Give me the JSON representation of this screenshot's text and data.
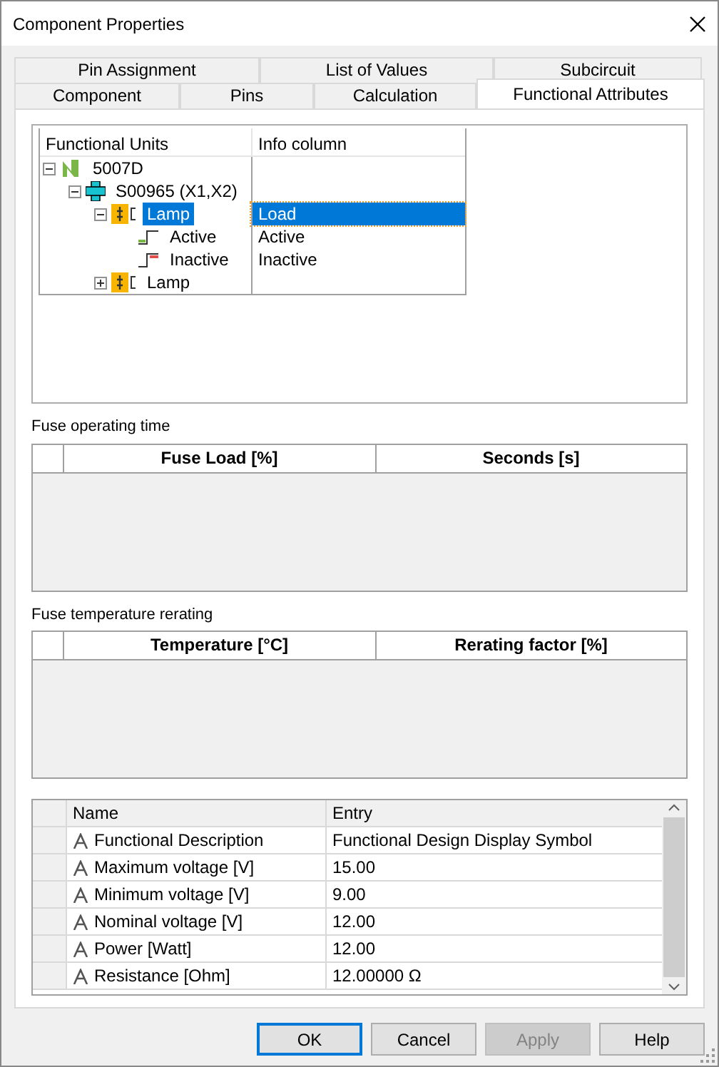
{
  "window": {
    "title": "Component Properties"
  },
  "tab_rows": [
    [
      {
        "label": "Pin Assignment",
        "selected": false
      },
      {
        "label": "List of Values",
        "selected": false
      },
      {
        "label": "Subcircuit",
        "selected": false
      }
    ],
    [
      {
        "label": "Component",
        "selected": false
      },
      {
        "label": "Pins",
        "selected": false
      },
      {
        "label": "Calculation",
        "selected": false
      },
      {
        "label": "Functional Attributes",
        "selected": true
      }
    ]
  ],
  "tree": {
    "columns": [
      "Functional Units",
      "Info column"
    ],
    "items": [
      {
        "label": "5007D",
        "kind": "device",
        "expanded": true,
        "selected": false,
        "children": [
          {
            "label": "S00965 (X1,X2)",
            "kind": "connector",
            "expanded": true,
            "selected": false,
            "children": [
              {
                "label": "Lamp",
                "kind": "lamp",
                "info": "Load",
                "expanded": true,
                "selected": true,
                "children": [
                  {
                    "label": "Active",
                    "kind": "active",
                    "info": "Active",
                    "selected": false
                  },
                  {
                    "label": "Inactive",
                    "kind": "inactive",
                    "info": "Inactive",
                    "selected": false
                  }
                ]
              },
              {
                "label": "Lamp",
                "kind": "lamp",
                "expanded": false,
                "selected": false
              }
            ]
          }
        ]
      }
    ]
  },
  "fuse_operating_time": {
    "label": "Fuse operating time",
    "columns": [
      "Fuse Load [%]",
      "Seconds [s]"
    ]
  },
  "fuse_temperature_rerating": {
    "label": "Fuse temperature rerating",
    "columns": [
      "Temperature [°C]",
      "Rerating factor [%]"
    ]
  },
  "properties": {
    "columns": [
      "Name",
      "Entry"
    ],
    "rows": [
      {
        "name": "Functional Description",
        "entry": "Functional Design Display Symbol"
      },
      {
        "name": "Maximum voltage [V]",
        "entry": "15.00"
      },
      {
        "name": "Minimum voltage [V]",
        "entry": "9.00"
      },
      {
        "name": "Nominal voltage [V]",
        "entry": "12.00"
      },
      {
        "name": "Power [Watt]",
        "entry": "12.00"
      },
      {
        "name": "Resistance [Ohm]",
        "entry": "12.00000 Ω"
      }
    ]
  },
  "buttons": [
    {
      "label": "OK",
      "default": true,
      "disabled": false
    },
    {
      "label": "Cancel",
      "default": false,
      "disabled": false
    },
    {
      "label": "Apply",
      "default": false,
      "disabled": true
    },
    {
      "label": "Help",
      "default": false,
      "disabled": false
    }
  ]
}
